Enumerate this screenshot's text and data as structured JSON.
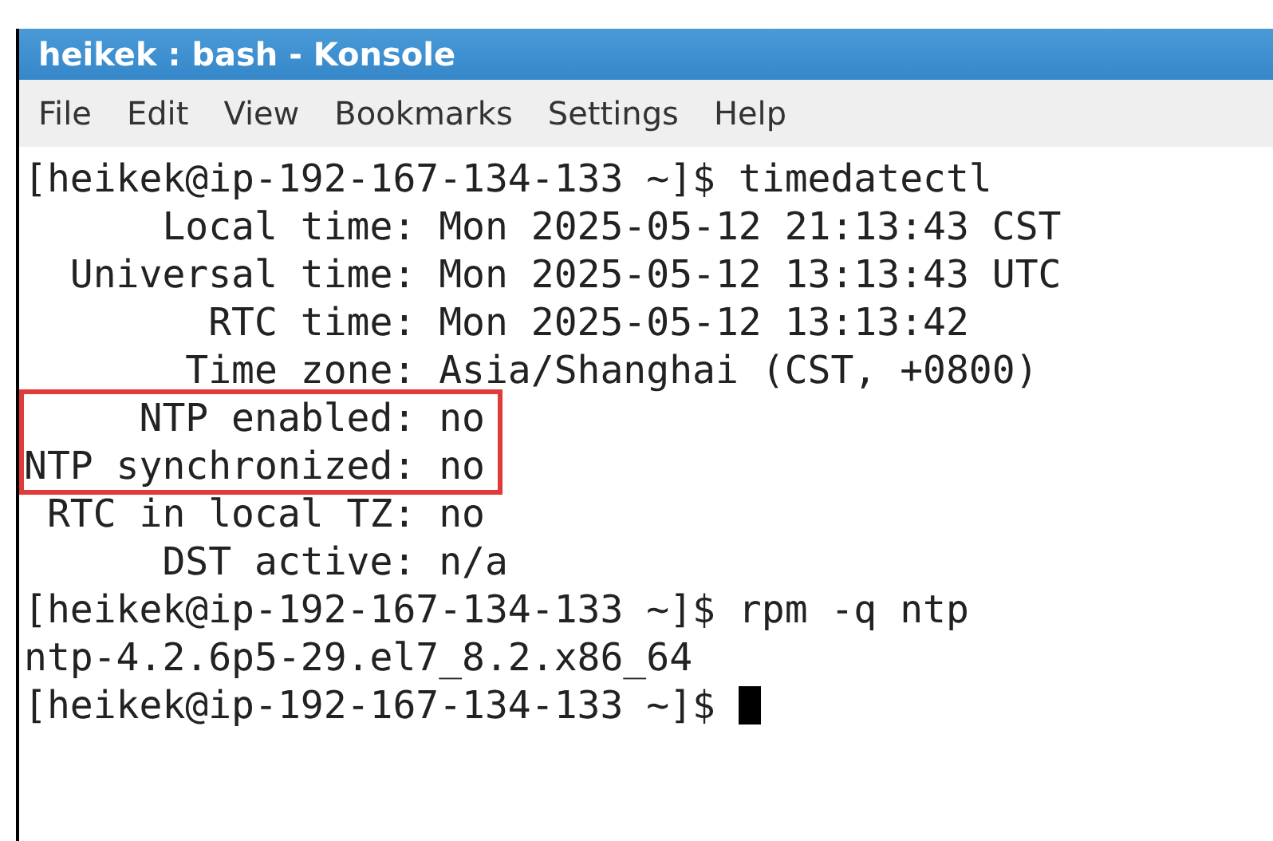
{
  "window": {
    "title": "heikek : bash - Konsole"
  },
  "menu": [
    "File",
    "Edit",
    "View",
    "Bookmarks",
    "Settings",
    "Help"
  ],
  "terminal": {
    "lines": [
      {
        "text": "[heikek@ip-192-167-134-133 ~]$ timedatectl",
        "highlighted": false,
        "cursor": false
      },
      {
        "text": "      Local time: Mon 2025-05-12 21:13:43 CST",
        "highlighted": false,
        "cursor": false
      },
      {
        "text": "  Universal time: Mon 2025-05-12 13:13:43 UTC",
        "highlighted": false,
        "cursor": false
      },
      {
        "text": "        RTC time: Mon 2025-05-12 13:13:42",
        "highlighted": false,
        "cursor": false
      },
      {
        "text": "       Time zone: Asia/Shanghai (CST, +0800)",
        "highlighted": false,
        "cursor": false
      },
      {
        "text": "     NTP enabled: no",
        "highlighted": true,
        "cursor": false
      },
      {
        "text": "NTP synchronized: no",
        "highlighted": true,
        "cursor": false
      },
      {
        "text": " RTC in local TZ: no",
        "highlighted": false,
        "cursor": false
      },
      {
        "text": "      DST active: n/a",
        "highlighted": false,
        "cursor": false
      },
      {
        "text": "[heikek@ip-192-167-134-133 ~]$ rpm -q ntp",
        "highlighted": false,
        "cursor": false
      },
      {
        "text": "ntp-4.2.6p5-29.el7_8.2.x86_64",
        "highlighted": false,
        "cursor": false
      },
      {
        "text": "[heikek@ip-192-167-134-133 ~]$ ",
        "highlighted": false,
        "cursor": true
      }
    ]
  }
}
